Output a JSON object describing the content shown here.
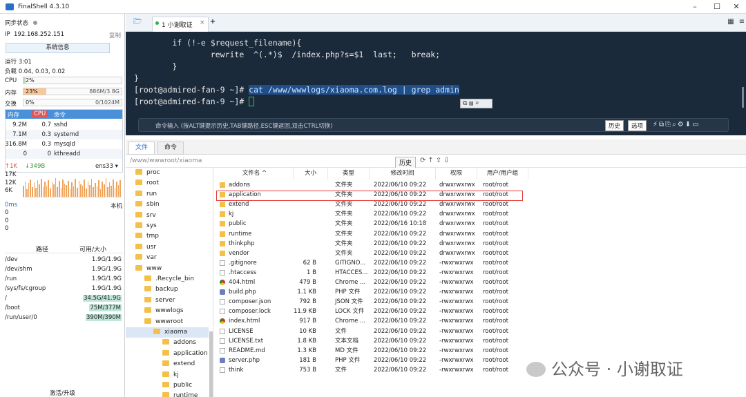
{
  "app": {
    "title": "FinalShell 4.3.10"
  },
  "left": {
    "sync_label": "同步状态",
    "ip_label": "IP",
    "ip": "192.168.252.151",
    "copy": "复制",
    "sysinfo_button": "系统信息",
    "uptime": "运行 3:01",
    "load": "负载 0.04, 0.03, 0.02",
    "cpu_label": "CPU",
    "cpu_value": "2%",
    "cpu_fraction": 0.02,
    "mem_label": "内存",
    "mem_percent": "23%",
    "mem_fraction": 0.23,
    "mem_value": "886M/3.8G",
    "swap_label": "交换",
    "swap_percent": "0%",
    "swap_value": "0/1024M",
    "proc_headers": [
      "内存",
      "CPU",
      "命令"
    ],
    "procs": [
      {
        "mem": "9.2M",
        "cpu": "0.7",
        "cmd": "sshd"
      },
      {
        "mem": "7.1M",
        "cpu": "0.3",
        "cmd": "systemd"
      },
      {
        "mem": "316.8M",
        "cpu": "0.3",
        "cmd": "mysqld"
      },
      {
        "mem": "0",
        "cpu": "0",
        "cmd": "kthreadd"
      }
    ],
    "net_up": "1K",
    "net_down": "349B",
    "net_iface": "ens33",
    "net_axis": [
      "17K",
      "12K",
      "6K"
    ],
    "net_bars": [
      0.45,
      0.62,
      0.3,
      0.55,
      0.7,
      0.4,
      0.58,
      0.35,
      0.66,
      0.5,
      0.72,
      0.38,
      0.6,
      0.44,
      0.68,
      0.33,
      0.57,
      0.49,
      0.75,
      0.4,
      0.63,
      0.36,
      0.7,
      0.52,
      0.46,
      0.65,
      0.3,
      0.59,
      0.42,
      0.71,
      0.37,
      0.64,
      0.5,
      0.45,
      0.69,
      0.34,
      0.61,
      0.48,
      0.73,
      0.39,
      0.56,
      0.43,
      0.67,
      0.31,
      0.62,
      0.51,
      0.74,
      0.4,
      0.58,
      0.45,
      0.7,
      0.36,
      0.6,
      0.47,
      0.66
    ],
    "latency_label": "0ms",
    "latency_host": "本机",
    "latency_values": [
      "0",
      "0",
      "0"
    ],
    "disk_headers": [
      "路径",
      "可用/大小"
    ],
    "disks": [
      {
        "path": "/dev",
        "size": "1.9G/1.9G"
      },
      {
        "path": "/dev/shm",
        "size": "1.9G/1.9G"
      },
      {
        "path": "/run",
        "size": "1.9G/1.9G"
      },
      {
        "path": "/sys/fs/cgroup",
        "size": "1.9G/1.9G"
      },
      {
        "path": "/",
        "size": "34.5G/41.9G"
      },
      {
        "path": "/boot",
        "size": "75M/377M"
      },
      {
        "path": "/run/user/0",
        "size": "390M/390M"
      }
    ],
    "activate": "激活/升级"
  },
  "tabs": {
    "session_tab": "1 小谢取证",
    "add": "+"
  },
  "terminal": {
    "lines": [
      "        if (!-e $request_filename){",
      "                rewrite  ^(.*)$  /index.php?s=$1  last;   break;",
      "        }",
      "}"
    ],
    "prompt1": "[root@admired-fan-9 ~]# ",
    "cmd1": "cat /www/wwwlogs/xiaoma.com.log | grep admin",
    "prompt2": "[root@admired-fan-9 ~]# ",
    "cmdbar_hint": "命令输入 (按ALT键提示历史,TAB键路径,ESC键返回,双击CTRL切换)",
    "history_btn": "历史",
    "options_btn": "选项"
  },
  "files": {
    "tab_files": "文件",
    "tab_cmd": "命令",
    "path": "/www/wwwroot/xiaoma",
    "history_btn": "历史",
    "tree": [
      {
        "name": "proc",
        "indent": 0
      },
      {
        "name": "root",
        "indent": 0
      },
      {
        "name": "run",
        "indent": 0
      },
      {
        "name": "sbin",
        "indent": 0
      },
      {
        "name": "srv",
        "indent": 0
      },
      {
        "name": "sys",
        "indent": 0
      },
      {
        "name": "tmp",
        "indent": 0
      },
      {
        "name": "usr",
        "indent": 0
      },
      {
        "name": "var",
        "indent": 0
      },
      {
        "name": "www",
        "indent": 0
      },
      {
        "name": ".Recycle_bin",
        "indent": 1
      },
      {
        "name": "backup",
        "indent": 1
      },
      {
        "name": "server",
        "indent": 1
      },
      {
        "name": "wwwlogs",
        "indent": 1
      },
      {
        "name": "wwwroot",
        "indent": 1
      },
      {
        "name": "xiaoma",
        "indent": 2
      },
      {
        "name": "addons",
        "indent": 3
      },
      {
        "name": "application",
        "indent": 3
      },
      {
        "name": "extend",
        "indent": 3
      },
      {
        "name": "kj",
        "indent": 3
      },
      {
        "name": "public",
        "indent": 3
      },
      {
        "name": "runtime",
        "indent": 3
      }
    ],
    "headers": [
      "文件名 ^",
      "大小",
      "类型",
      "修改时间",
      "权限",
      "用户/用户组"
    ],
    "rows": [
      {
        "name": "addons",
        "size": "",
        "type": "文件夹",
        "mtime": "2022/06/10 09:22",
        "perm": "drwxrwxrwx",
        "owner": "root/root",
        "icon": "folder"
      },
      {
        "name": "application",
        "size": "",
        "type": "文件夹",
        "mtime": "2022/06/10 09:22",
        "perm": "drwxrwxrwx",
        "owner": "root/root",
        "icon": "folder"
      },
      {
        "name": "extend",
        "size": "",
        "type": "文件夹",
        "mtime": "2022/06/10 09:22",
        "perm": "drwxrwxrwx",
        "owner": "root/root",
        "icon": "folder"
      },
      {
        "name": "kj",
        "size": "",
        "type": "文件夹",
        "mtime": "2022/06/10 09:22",
        "perm": "drwxrwxrwx",
        "owner": "root/root",
        "icon": "folder"
      },
      {
        "name": "public",
        "size": "",
        "type": "文件夹",
        "mtime": "2022/06/16 10:18",
        "perm": "drwxrwxrwx",
        "owner": "root/root",
        "icon": "folder"
      },
      {
        "name": "runtime",
        "size": "",
        "type": "文件夹",
        "mtime": "2022/06/10 09:22",
        "perm": "drwxrwxrwx",
        "owner": "root/root",
        "icon": "folder"
      },
      {
        "name": "thinkphp",
        "size": "",
        "type": "文件夹",
        "mtime": "2022/06/10 09:22",
        "perm": "drwxrwxrwx",
        "owner": "root/root",
        "icon": "folder"
      },
      {
        "name": "vendor",
        "size": "",
        "type": "文件夹",
        "mtime": "2022/06/10 09:22",
        "perm": "drwxrwxrwx",
        "owner": "root/root",
        "icon": "folder"
      },
      {
        "name": ".gitignore",
        "size": "62 B",
        "type": "GITIGNO...",
        "mtime": "2022/06/10 09:22",
        "perm": "-rwxrwxrwx",
        "owner": "root/root",
        "icon": "file"
      },
      {
        "name": ".htaccess",
        "size": "1 B",
        "type": "HTACCES...",
        "mtime": "2022/06/10 09:22",
        "perm": "-rwxrwxrwx",
        "owner": "root/root",
        "icon": "file"
      },
      {
        "name": "404.html",
        "size": "479 B",
        "type": "Chrome ...",
        "mtime": "2022/06/10 09:22",
        "perm": "-rwxrwxrwx",
        "owner": "root/root",
        "icon": "chrome"
      },
      {
        "name": "build.php",
        "size": "1.1 KB",
        "type": "PHP 文件",
        "mtime": "2022/06/10 09:22",
        "perm": "-rwxrwxrwx",
        "owner": "root/root",
        "icon": "php"
      },
      {
        "name": "composer.json",
        "size": "792 B",
        "type": "JSON 文件",
        "mtime": "2022/06/10 09:22",
        "perm": "-rwxrwxrwx",
        "owner": "root/root",
        "icon": "file"
      },
      {
        "name": "composer.lock",
        "size": "11.9 KB",
        "type": "LOCK 文件",
        "mtime": "2022/06/10 09:22",
        "perm": "-rwxrwxrwx",
        "owner": "root/root",
        "icon": "file"
      },
      {
        "name": "index.html",
        "size": "917 B",
        "type": "Chrome ...",
        "mtime": "2022/06/10 09:22",
        "perm": "-rwxrwxrwx",
        "owner": "root/root",
        "icon": "chrome"
      },
      {
        "name": "LICENSE",
        "size": "10 KB",
        "type": "文件",
        "mtime": "2022/06/10 09:22",
        "perm": "-rwxrwxrwx",
        "owner": "root/root",
        "icon": "file"
      },
      {
        "name": "LICENSE.txt",
        "size": "1.8 KB",
        "type": "文本文档",
        "mtime": "2022/06/10 09:22",
        "perm": "-rwxrwxrwx",
        "owner": "root/root",
        "icon": "file"
      },
      {
        "name": "README.md",
        "size": "1.3 KB",
        "type": "MD 文件",
        "mtime": "2022/06/10 09:22",
        "perm": "-rwxrwxrwx",
        "owner": "root/root",
        "icon": "file"
      },
      {
        "name": "server.php",
        "size": "181 B",
        "type": "PHP 文件",
        "mtime": "2022/06/10 09:22",
        "perm": "-rwxrwxrwx",
        "owner": "root/root",
        "icon": "php"
      },
      {
        "name": "think",
        "size": "753 B",
        "type": "文件",
        "mtime": "2022/06/10 09:22",
        "perm": "-rwxrwxrwx",
        "owner": "root/root",
        "icon": "file"
      }
    ]
  },
  "watermark": "公众号 · 小谢取证",
  "colors": {
    "terminal_bg": "#1b2a3b",
    "accent": "#4a90d9",
    "highlight": "#e53935"
  }
}
